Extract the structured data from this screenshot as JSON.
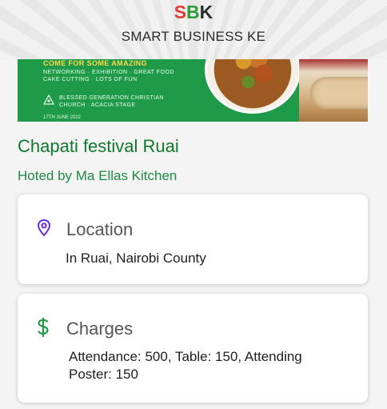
{
  "header": {
    "logo": {
      "s": "S",
      "b": "B",
      "k": "K"
    },
    "brand_name": "SMART BUSINESS KE"
  },
  "banner": {
    "headline": "COME FOR SOME AMAZING",
    "line1": "NETWORKING · EXHIBITION · GREAT FOOD",
    "line2": "CAKE CUTTING · LOTS OF FUN",
    "venue_line1": "BLESSED GENERATION CHRISTIAN",
    "venue_line2": "CHURCH · ACACIA STAGE",
    "date": "17TH JUNE 2022"
  },
  "event": {
    "title": "Chapati festival Ruai",
    "host": "Hoted by Ma Ellas Kitchen"
  },
  "location_card": {
    "icon": "map-pin-icon",
    "heading": "Location",
    "value": "In Ruai, Nairobi County"
  },
  "charges_card": {
    "icon": "dollar-icon",
    "heading": "Charges",
    "value": "Attendance: 500, Table: 150, Attending Poster: 150"
  },
  "colors": {
    "brand_green": "#0f7a2c",
    "logo_red": "#e53935",
    "icon_purple": "#6a2bd9",
    "icon_green": "#1f9a49"
  }
}
